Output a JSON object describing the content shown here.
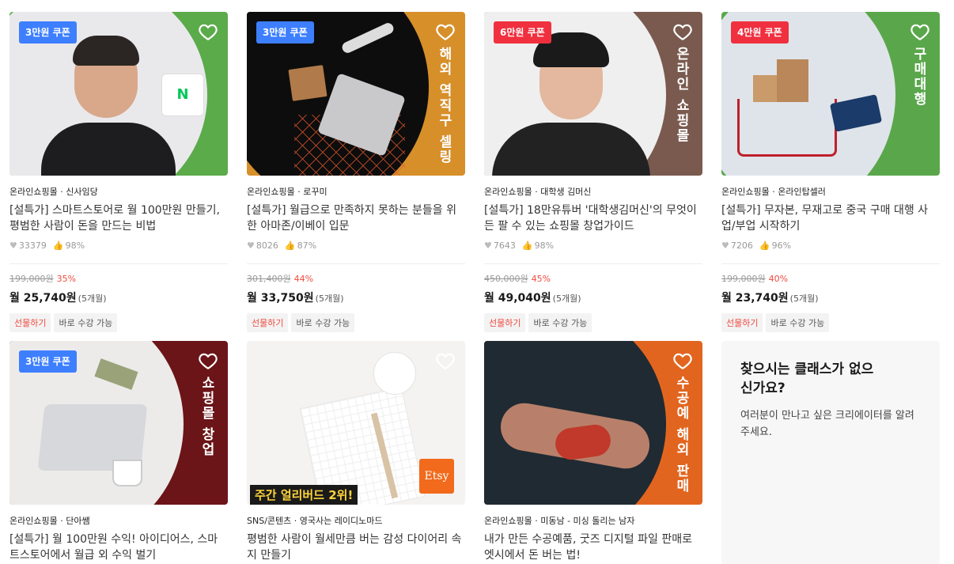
{
  "cards": [
    {
      "coupon": "3만원 쿠폰",
      "coupon_color": "#3d7fff",
      "side_text": "",
      "category": "온라인쇼핑몰 · 신사임당",
      "title": "[설특가] 스마트스토어로 월 100만원 만들기, 평범한 사람이 돈을 만드는 비법",
      "likes": "33379",
      "rating": "98%",
      "orig_price": "199,000원",
      "discount": "35%",
      "monthly": "월 25,740원",
      "months": "(5개월)",
      "tag_gift": "선물하기",
      "tag_now": "바로 수강 가능"
    },
    {
      "coupon": "3만원 쿠폰",
      "coupon_color": "#3d7fff",
      "side_text": "해외 역직구 셀링",
      "category": "온라인쇼핑몰 · 로꾸미",
      "title": "[설특가] 월급으로 만족하지 못하는 분들을 위한 아마존/이베이 입문",
      "likes": "8026",
      "rating": "87%",
      "orig_price": "301,400원",
      "discount": "44%",
      "monthly": "월 33,750원",
      "months": "(5개월)",
      "tag_gift": "선물하기",
      "tag_now": "바로 수강 가능"
    },
    {
      "coupon": "6만원 쿠폰",
      "coupon_color": "#f0303f",
      "side_text": "온라인 쇼핑몰",
      "category": "온라인쇼핑몰 · 대학생 김머신",
      "title": "[설특가] 18만유튜버 '대학생김머신'의 무엇이든 팔 수 있는 쇼핑몰 창업가이드",
      "likes": "7643",
      "rating": "98%",
      "orig_price": "450,000원",
      "discount": "45%",
      "monthly": "월 49,040원",
      "months": "(5개월)",
      "tag_gift": "선물하기",
      "tag_now": "바로 수강 가능"
    },
    {
      "coupon": "4만원 쿠폰",
      "coupon_color": "#f0303f",
      "side_text": "구매대행",
      "category": "온라인쇼핑몰 · 온라인탑셀러",
      "title": "[설특가] 무자본, 무재고로 중국 구매 대행 사업/부업 시작하기",
      "likes": "7206",
      "rating": "96%",
      "orig_price": "199,000원",
      "discount": "40%",
      "monthly": "월 23,740원",
      "months": "(5개월)",
      "tag_gift": "선물하기",
      "tag_now": "바로 수강 가능"
    },
    {
      "coupon": "3만원 쿠폰",
      "coupon_color": "#3d7fff",
      "side_text": "쇼핑몰 창업",
      "category": "온라인쇼핑몰 · 단아쌤",
      "title": "[설특가] 월 100만원 수익! 아이디어스, 스마트스토어에서 월급 외 수익 벌기"
    },
    {
      "coupon": "",
      "side_text": "",
      "overlay": "주간 얼리버드 2위!",
      "etsy": "Etsy",
      "category": "SNS/콘텐츠 · 영국사는 레이디노마드",
      "title": "평범한 사람이 월세만큼 버는 감성 다이어리 속지 만들기"
    },
    {
      "coupon": "",
      "side_text": "수공예 해외 판매",
      "category": "온라인쇼핑몰 · 미동남 - 미싱 돌리는 남자",
      "title": "내가 만든 수공예품, 굿즈 디지털 파일 판매로 엣시에서 돈 버는 법!"
    }
  ],
  "promo": {
    "title": "찾으시는 클래스가 없으신가요?",
    "desc": "여러분이 만나고 싶은 크리에이터를 알려주세요."
  }
}
